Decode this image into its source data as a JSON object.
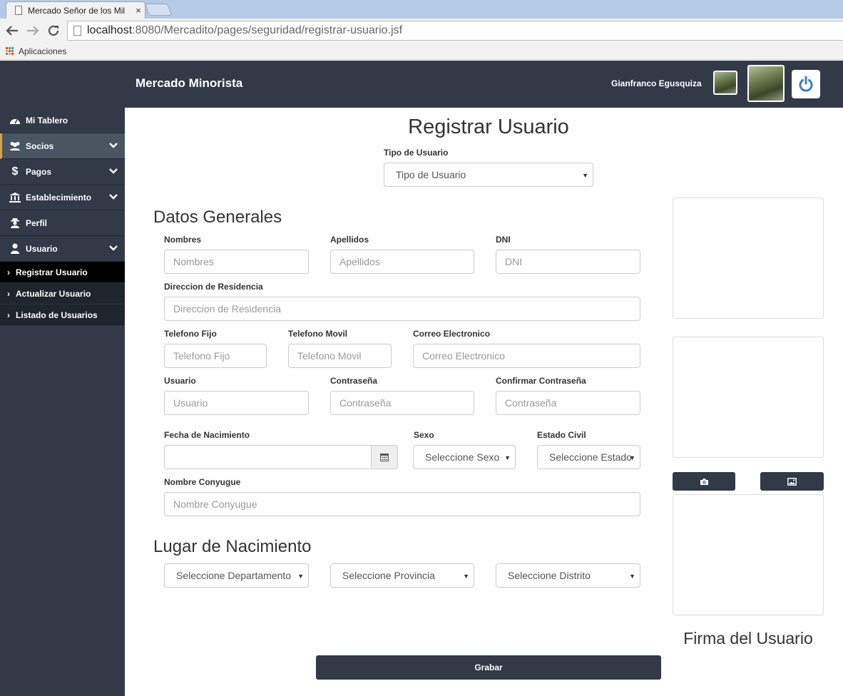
{
  "browser": {
    "tab_title": "Mercado Señor de los Mil",
    "tab_close": "×",
    "url_host": "localhost",
    "url_path": ":8080/Mercadito/pages/seguridad/registrar-usuario.jsf",
    "bookmark_apps": "Aplicaciones"
  },
  "header": {
    "brand": "Mercado Minorista",
    "user_name": "Gianfranco  Egusquiza"
  },
  "sidebar": {
    "items": [
      {
        "label": "Mi Tablero",
        "icon": "dashboard-icon"
      },
      {
        "label": "Socios",
        "icon": "users-icon",
        "has_chevron": true,
        "active": true
      },
      {
        "label": "Pagos",
        "icon": "dollar-icon",
        "has_chevron": true
      },
      {
        "label": "Establecimiento",
        "icon": "bank-icon",
        "has_chevron": true
      },
      {
        "label": "Perfil",
        "icon": "user-secret-icon"
      },
      {
        "label": "Usuario",
        "icon": "user-icon",
        "has_chevron": true
      }
    ],
    "subitems": [
      {
        "label": "Registrar Usuario"
      },
      {
        "label": "Actualizar Usuario"
      },
      {
        "label": "Listado de Usuarios"
      }
    ]
  },
  "form": {
    "title": "Registrar Usuario",
    "tipo_label": "Tipo de Usuario",
    "tipo_value": "Tipo de Usuario",
    "section_generales": "Datos Generales",
    "nombres_label": "Nombres",
    "nombres_ph": "Nombres",
    "apellidos_label": "Apellidos",
    "apellidos_ph": "Apellidos",
    "dni_label": "DNI",
    "dni_ph": "DNI",
    "direccion_label": "Direccion de Residencia",
    "direccion_ph": "Direccion de Residencia",
    "telfijo_label": "Telefono Fijo",
    "telfijo_ph": "Telefono Fijo",
    "telmovil_label": "Telefono Movil",
    "telmovil_ph": "Telefono Movil",
    "correo_label": "Correo Electronico",
    "correo_ph": "Correo Electronico",
    "usuario_label": "Usuario",
    "usuario_ph": "Usuario",
    "contrasena_label": "Contraseña",
    "contrasena_ph": "Contraseña",
    "confirmar_label": "Confirmar Contraseña",
    "confirmar_ph": "Contraseña",
    "fecha_label": "Fecha de Nacimiento",
    "fecha_value": "",
    "sexo_label": "Sexo",
    "sexo_value": "Seleccione Sexo",
    "estado_label": "Estado Civil",
    "estado_value": "Seleccione Estado",
    "conyugue_label": "Nombre Conyugue",
    "conyugue_ph": "Nombre Conyugue",
    "section_lugar": "Lugar de Nacimiento",
    "departamento_value": "Seleccione Departamento",
    "provincia_value": "Seleccione Provincia",
    "distrito_value": "Seleccione Distrito",
    "firma_label": "Firma del Usuario",
    "grabar_label": "Grabar"
  },
  "colors": {
    "header_bg": "#313a46",
    "sidebar_active_accent": "#d9a441",
    "power_icon": "#3a7fc1"
  }
}
